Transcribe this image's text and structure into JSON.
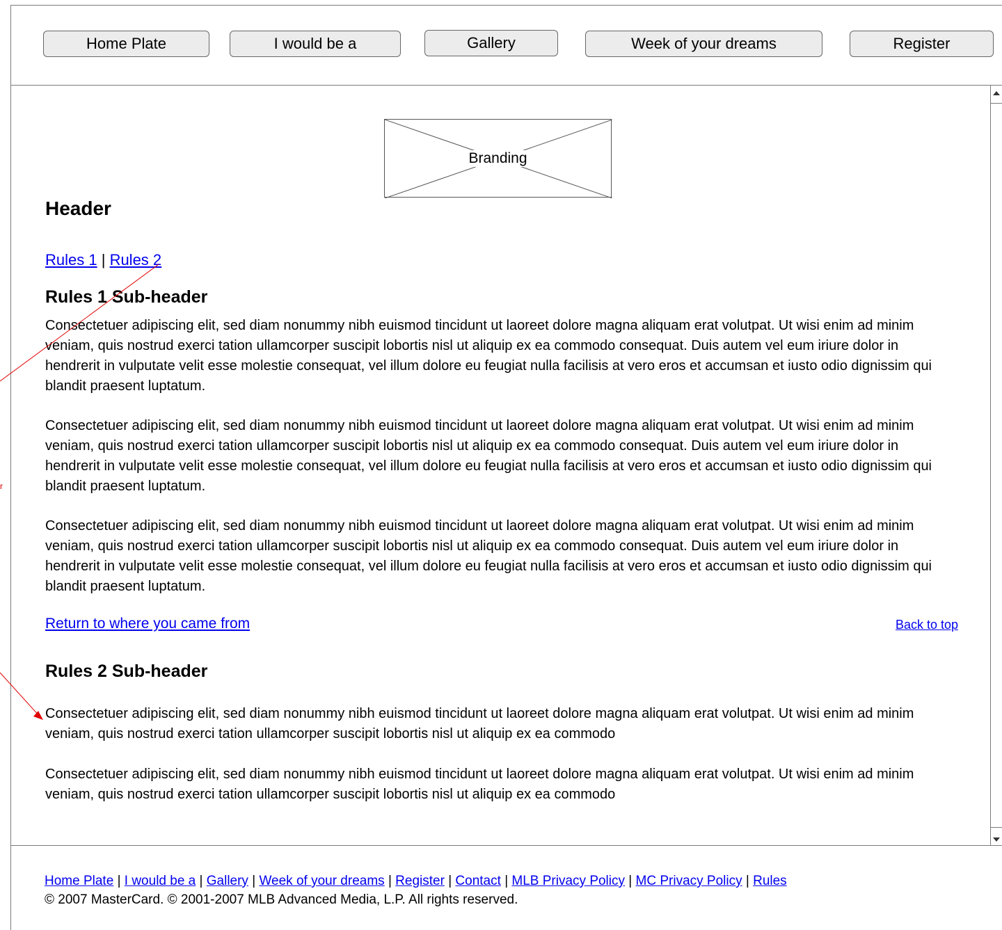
{
  "nav": {
    "items": [
      {
        "label": "Home Plate"
      },
      {
        "label": "I would be a"
      },
      {
        "label": "Gallery"
      },
      {
        "label": "Week of your dreams"
      },
      {
        "label": "Register"
      }
    ]
  },
  "branding": {
    "label": "Branding"
  },
  "page": {
    "header": "Header",
    "rules_links": [
      "Rules 1",
      "Rules 2"
    ],
    "rules_sep": "|",
    "rules1": {
      "subheader": "Rules 1 Sub-header",
      "paragraphs": [
        "Consectetuer adipiscing elit, sed diam nonummy nibh euismod tincidunt ut laoreet dolore magna aliquam erat volutpat. Ut wisi enim ad minim veniam, quis nostrud exerci tation ullamcorper suscipit lobortis nisl ut aliquip ex ea commodo consequat. Duis autem vel eum iriure dolor in hendrerit in vulputate velit esse molestie consequat, vel illum dolore eu feugiat nulla facilisis at vero eros et accumsan et iusto odio dignissim qui blandit praesent luptatum.",
        "Consectetuer adipiscing elit, sed diam nonummy nibh euismod tincidunt ut laoreet dolore magna aliquam erat volutpat. Ut wisi enim ad minim veniam, quis nostrud exerci tation ullamcorper suscipit lobortis nisl ut aliquip ex ea commodo consequat. Duis autem vel eum iriure dolor in hendrerit in vulputate velit esse molestie consequat, vel illum dolore eu feugiat nulla facilisis at vero eros et accumsan et iusto odio dignissim qui blandit praesent luptatum.",
        "Consectetuer adipiscing elit, sed diam nonummy nibh euismod tincidunt ut laoreet dolore magna aliquam erat volutpat. Ut wisi enim ad minim veniam, quis nostrud exerci tation ullamcorper suscipit lobortis nisl ut aliquip ex ea commodo consequat. Duis autem vel eum iriure dolor in hendrerit in vulputate velit esse molestie consequat, vel illum dolore eu feugiat nulla facilisis at vero eros et accumsan et iusto odio dignissim qui blandit praesent luptatum."
      ]
    },
    "return_link": "Return to where you came from",
    "back_to_top": "Back to top",
    "rules2": {
      "subheader": "Rules 2 Sub-header",
      "paragraphs": [
        "Consectetuer adipiscing elit, sed diam nonummy nibh euismod tincidunt ut laoreet dolore magna aliquam erat volutpat. Ut wisi enim ad minim veniam, quis nostrud exerci tation ullamcorper suscipit lobortis nisl ut aliquip ex ea commodo",
        "Consectetuer adipiscing elit, sed diam nonummy nibh euismod tincidunt ut laoreet dolore magna aliquam erat volutpat. Ut wisi enim ad minim veniam, quis nostrud exerci tation ullamcorper suscipit lobortis nisl ut aliquip ex ea commodo"
      ]
    }
  },
  "annotation": {
    "fragment": "r",
    "color": "#e00000"
  },
  "footer": {
    "links": [
      "Home Plate",
      "I would be a",
      "Gallery",
      "Week of your dreams",
      "Register",
      "Contact",
      "MLB Privacy Policy",
      "MC Privacy Policy",
      "Rules"
    ],
    "separator": "|",
    "copyright": "© 2007 MasterCard. © 2001-2007 MLB Advanced Media, L.P. All rights reserved."
  },
  "colors": {
    "link": "#0000ee",
    "border": "#7a7a7a",
    "button_bg": "#ececec"
  }
}
